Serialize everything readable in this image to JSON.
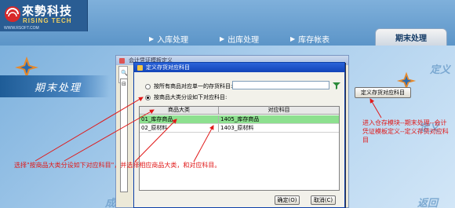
{
  "app": {
    "logo_cn": "來勢科技",
    "logo_en": "RISING TECH",
    "logo_web": "WWW.RSOFT.COM"
  },
  "nav": {
    "tabs": [
      "入库处理",
      "出库处理",
      "库存帐表"
    ],
    "active": "期末处理"
  },
  "background": {
    "banner": "期末处理",
    "ghost_right": "定义",
    "ghost_right2": "定义",
    "ghost_left": "成",
    "ghost_bottom_right": "返回"
  },
  "outer_dialog": {
    "title": "会计凭证模板定义"
  },
  "inner_dialog": {
    "title": "定义存货对应科目",
    "option1": "按所有商品对应单一的存货科目:",
    "option2": "按商品大类分设如下对应科目:",
    "subject_value": "",
    "selected_option": 2,
    "table": {
      "headers": [
        "商品大类",
        "对应科目"
      ],
      "rows": [
        [
          "01_库存商品",
          "1405_库存商品"
        ],
        [
          "02_原材料",
          "1403_原材料"
        ]
      ]
    },
    "define_button": "定义存货对应科目",
    "ok_button": "确定(O)",
    "cancel_button": "取消(C)"
  },
  "annotations": {
    "left": "选择\"按商品大类分设如下对应科目\"，并选择相应商品大类，和对应科目。",
    "right": "进入仓存模块--期末处理--会计凭证模板定义--定义存货对应科目"
  },
  "colors": {
    "annotation": "#e01818",
    "selected_row": "#8de08f",
    "title_bar": "#1244b8"
  }
}
